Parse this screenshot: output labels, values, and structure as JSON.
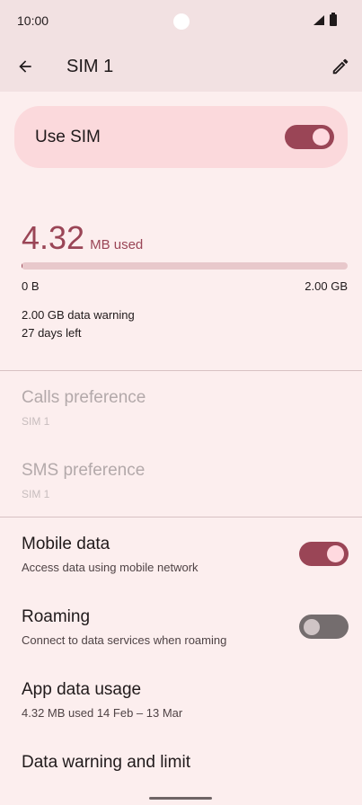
{
  "status_bar": {
    "time": "10:00",
    "icons": [
      "signal-icon",
      "battery-icon"
    ]
  },
  "app_bar": {
    "title": "SIM 1",
    "back_icon": "arrow-back-icon",
    "edit_icon": "pencil-icon"
  },
  "use_sim": {
    "label": "Use SIM",
    "enabled": true
  },
  "usage": {
    "amount": "4.32",
    "unit": "MB used",
    "fraction_used": 0.002,
    "min_label": "0 B",
    "max_label": "2.00 GB",
    "warning": "2.00 GB data warning",
    "days_left": "27 days left"
  },
  "preferences": {
    "calls": {
      "title": "Calls preference",
      "value": "SIM 1"
    },
    "sms": {
      "title": "SMS preference",
      "value": "SIM 1"
    }
  },
  "settings": {
    "mobile_data": {
      "title": "Mobile data",
      "subtitle": "Access data using mobile network",
      "enabled": true
    },
    "roaming": {
      "title": "Roaming",
      "subtitle": "Connect to data services when roaming",
      "enabled": false
    },
    "app_data_usage": {
      "title": "App data usage",
      "subtitle": "4.32 MB used 14 Feb – 13 Mar"
    },
    "data_warning_limit": {
      "title": "Data warning and limit"
    }
  },
  "colors": {
    "accent": "#9A4556",
    "background": "#FCEEEE",
    "card": "#FBD9DC",
    "header": "#F2E1E2"
  }
}
